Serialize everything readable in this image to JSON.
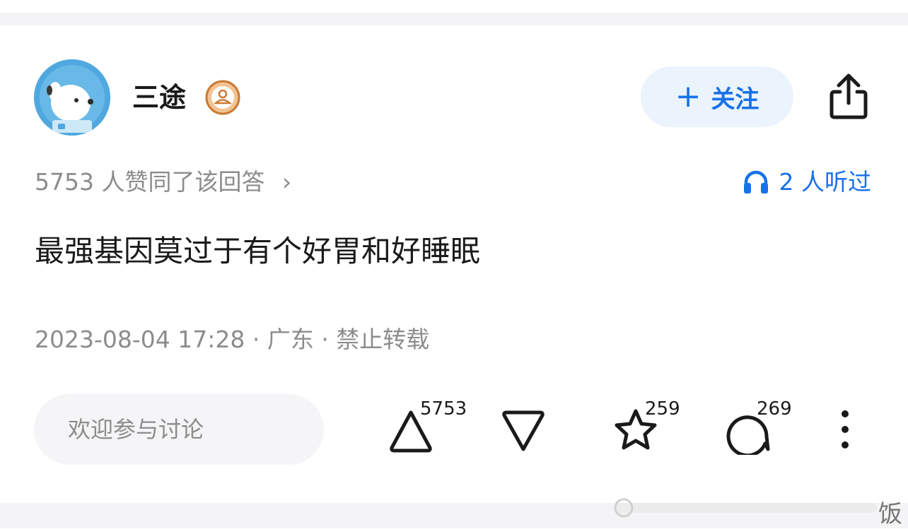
{
  "author": {
    "name": "三途",
    "badge_icon": "user-badge-icon",
    "avatar_icon": "dog-astronaut-avatar"
  },
  "header": {
    "follow_label": "关注",
    "follow_icon": "plus-icon",
    "share_icon": "share-icon"
  },
  "stats": {
    "agree_text": "5753 人赞同了该回答",
    "agree_chevron": "›",
    "listen_text": "2 人听过",
    "listen_icon": "headphones-icon"
  },
  "answer": {
    "text": "最强基因莫过于有个好胃和好睡眠"
  },
  "meta": {
    "text": "2023-08-04 17:28 · 广东 · 禁止转载"
  },
  "actions": {
    "comment_placeholder": "欢迎参与讨论",
    "upvote_count": "5753",
    "downvote_icon": "downvote-icon",
    "favorite_count": "259",
    "comment_count": "269",
    "more_icon": "more-vertical-icon"
  },
  "watermark": {
    "text": "饭"
  },
  "colors": {
    "accent": "#1772e8",
    "follow_bg": "#ebf3fd",
    "muted_text": "#8c8c8c",
    "primary_text": "#1a1a1a",
    "divider": "#f4f4f6",
    "badge": "#e39a55"
  }
}
